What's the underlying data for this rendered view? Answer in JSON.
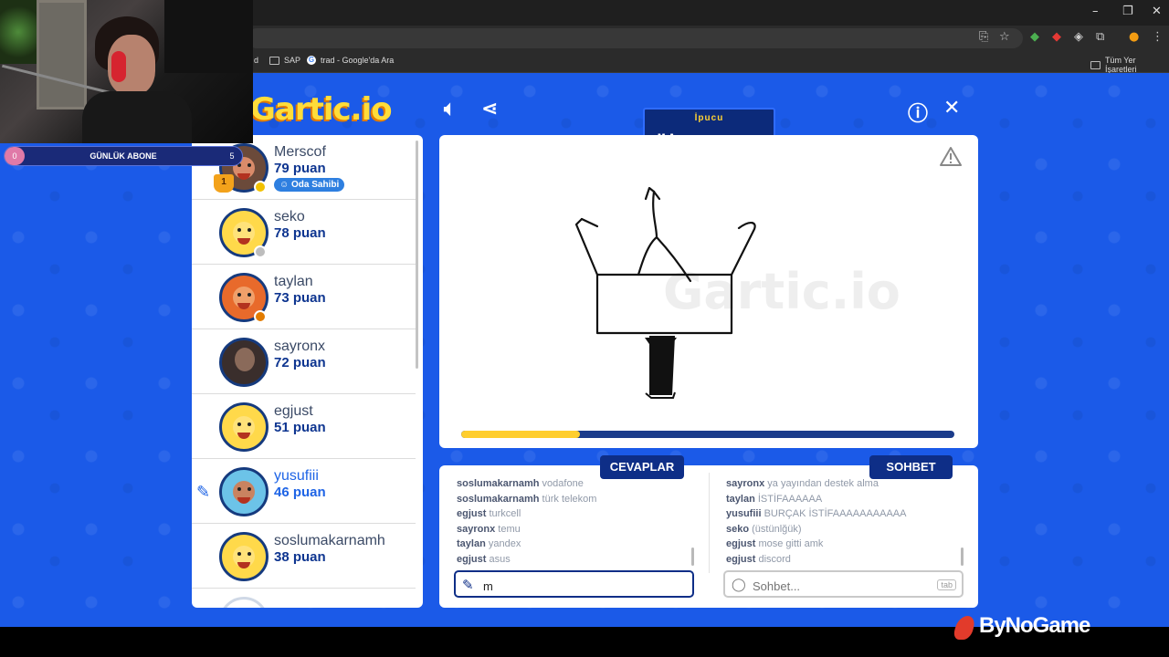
{
  "browser": {
    "bookmarks": [
      "d",
      "SAP",
      "trad - Google'da Ara"
    ],
    "all_bookmarks": "Tüm Yer İşaretleri"
  },
  "overlay": {
    "label": "GÜNLÜK ABONE",
    "left_count": "0",
    "right_count": "5",
    "watermark": "ByNoGame"
  },
  "game": {
    "logo": "Gartic.io",
    "hint": {
      "title": "İpucu",
      "word": "MA"
    },
    "progress_fraction": 0.24,
    "players": [
      {
        "name": "Merscof",
        "score": "79 puan",
        "badge": "Oda Sahibi",
        "rank": "1",
        "dot": "#f2c100"
      },
      {
        "name": "seko",
        "score": "78 puan",
        "dot": "#bdbdbd"
      },
      {
        "name": "taylan",
        "score": "73 puan",
        "dot": "#e27b00"
      },
      {
        "name": "sayronx",
        "score": "72 puan"
      },
      {
        "name": "egjust",
        "score": "51 puan"
      },
      {
        "name": "yusufiii",
        "score": "46 puan"
      },
      {
        "name": "soslumakarnamh",
        "score": "38 puan"
      }
    ],
    "answers_tab": "CEVAPLAR",
    "chat_tab": "SOHBET",
    "answers": [
      {
        "user": "soslumakarnamh",
        "text": "vodafone"
      },
      {
        "user": "soslumakarnamh",
        "text": "türk telekom"
      },
      {
        "user": "egjust",
        "text": "turkcell"
      },
      {
        "user": "sayronx",
        "text": "temu"
      },
      {
        "user": "taylan",
        "text": "yandex"
      },
      {
        "user": "egjust",
        "text": "asus"
      }
    ],
    "chat": [
      {
        "user": "sayronx",
        "text": "ya yayından destek alma"
      },
      {
        "user": "taylan",
        "text": "İSTİFAAAAAA"
      },
      {
        "user": "yusufiii",
        "text": "BURÇAK İSTİFAAAAAAAAAAA"
      },
      {
        "user": "seko",
        "text": "(üstünlğük)"
      },
      {
        "user": "egjust",
        "text": "mose gitti amk"
      },
      {
        "user": "egjust",
        "text": "discord"
      }
    ],
    "answer_input_value": "m",
    "chat_input_placeholder": "Sohbet...",
    "tab_key": "tab"
  }
}
